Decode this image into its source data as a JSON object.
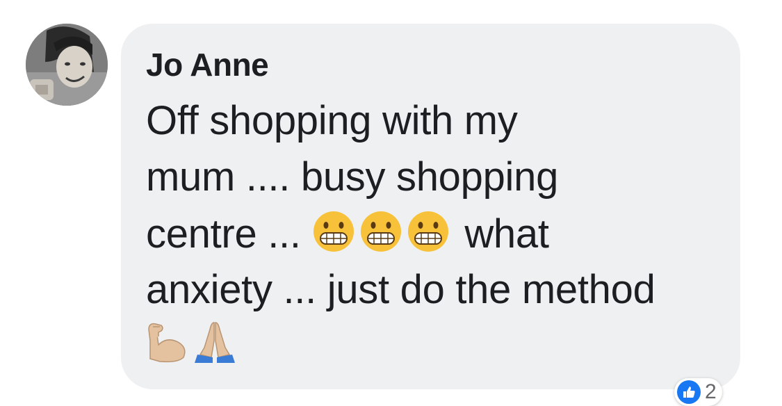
{
  "comment": {
    "author": "Jo Anne",
    "text_lines": [
      "Off shopping with my",
      "mum .... busy shopping",
      "centre ...",
      "what",
      "anxiety ... just do the method"
    ],
    "emojis_line3": [
      "grimacing-face-emoji",
      "grimacing-face-emoji",
      "grimacing-face-emoji"
    ],
    "emojis_line5": [
      "flexed-biceps-emoji",
      "folded-hands-emoji"
    ]
  },
  "reactions": {
    "icon": "like-icon",
    "count": "2"
  },
  "colors": {
    "bubble": "#eff0f2",
    "text": "#1c1e21",
    "like_blue": "#1877f2"
  }
}
